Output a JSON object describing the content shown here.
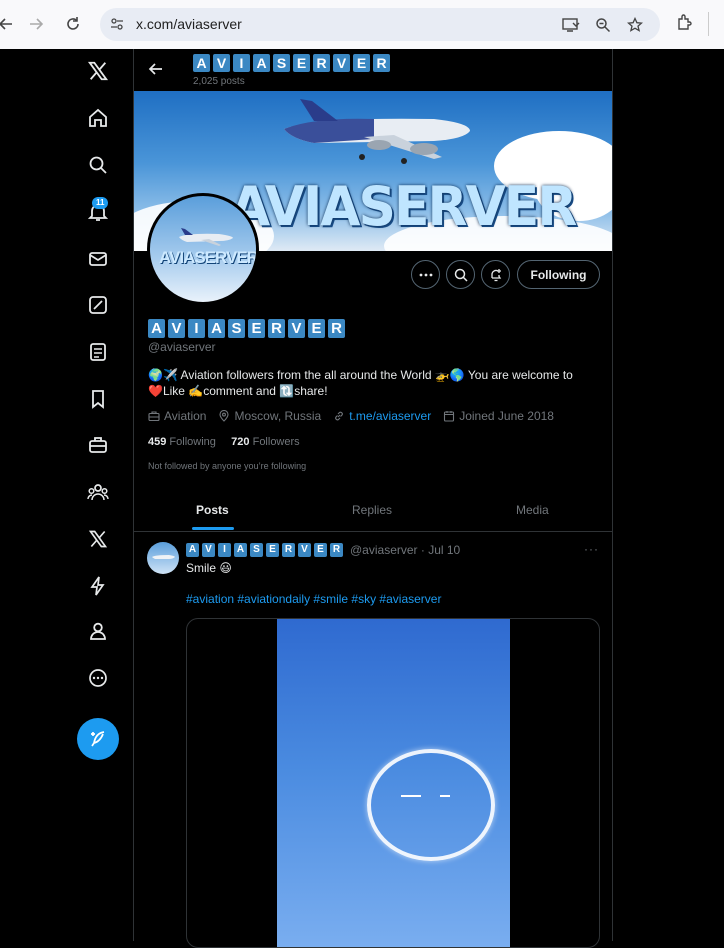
{
  "browser": {
    "url": "x.com/aviaserver"
  },
  "nav": {
    "notifications_badge": "11"
  },
  "profile": {
    "display_name_letters": [
      "A",
      "V",
      "I",
      "A",
      "S",
      "E",
      "R",
      "V",
      "E",
      "R"
    ],
    "post_count": "2,025 posts",
    "banner_text": "AVIASERVER",
    "avatar_text": "AVIASERVER",
    "handle": "@aviaserver",
    "bio_line1": "🌍✈️ Aviation followers from the all around the World 🚁🌎  You are welcome to",
    "bio_line2": "❤️Like ✍️comment and 🔃share!",
    "category": "Aviation",
    "location": "Moscow, Russia",
    "website": "t.me/aviaserver",
    "joined": "Joined June 2018",
    "following_count": "459",
    "following_label": "Following",
    "followers_count": "720",
    "followers_label": "Followers",
    "not_followed": "Not followed by anyone you’re following",
    "following_button": "Following"
  },
  "tabs": [
    {
      "label": "Posts",
      "active": true
    },
    {
      "label": "Replies",
      "active": false
    },
    {
      "label": "Media",
      "active": false
    }
  ],
  "tweet": {
    "handle_date": "@aviaserver · Jul 10",
    "text": "Smile 😃",
    "hashtags": "#aviation #aviationdaily #smile #sky #aviaserver",
    "more": "···"
  },
  "colors": {
    "accent": "#1d9bf0",
    "letter_box": "#3b88c3"
  }
}
